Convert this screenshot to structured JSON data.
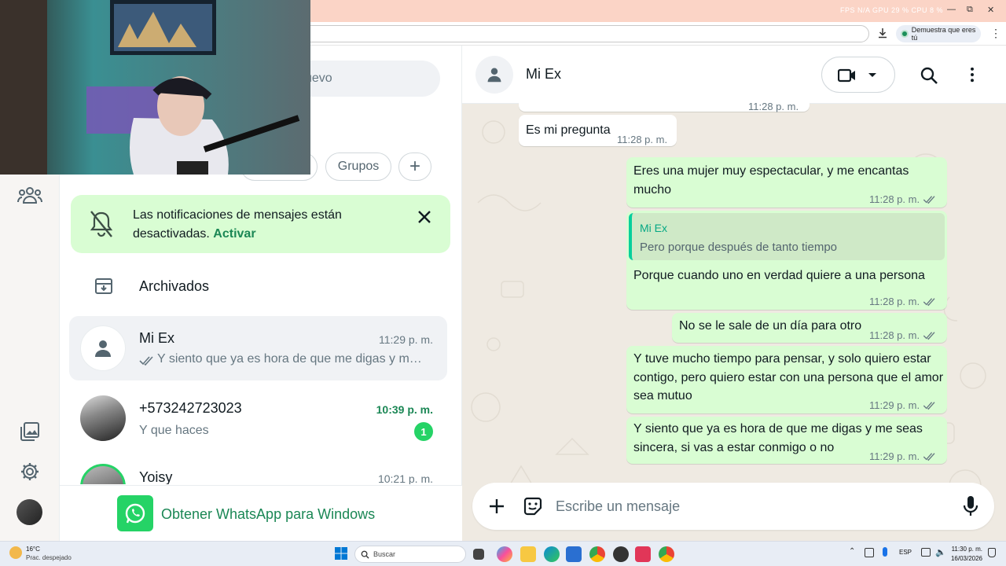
{
  "browser": {
    "stats_text": "FPS N/A   GPU 29 %   CPU 8 %",
    "verify_pill": "Demuestra que eres tú"
  },
  "list": {
    "search_placeholder": "uevo",
    "filters": [
      "Grupos"
    ],
    "notification": {
      "text": "Las notificaciones de mensajes están desactivadas.",
      "action": "Activar"
    },
    "archived_label": "Archivados",
    "chats": [
      {
        "name": "Mi Ex",
        "time": "11:29 p. m.",
        "preview": "Y siento que ya es hora de que me digas y me seas sincera, si vas a estar conmigo o no",
        "read_ticks": true,
        "unread": null
      },
      {
        "name": "+573242723023",
        "time": "10:39 p. m.",
        "preview": "Y que haces",
        "read_ticks": false,
        "unread": "1"
      },
      {
        "name": "Yoisy",
        "time": "10:21 p. m.",
        "preview": "",
        "read_ticks": false,
        "unread": null
      }
    ],
    "get_app_label": "Obtener WhatsApp para Windows"
  },
  "conversation": {
    "contact_name": "Mi Ex",
    "partial_time": "11:28 p. m.",
    "messages": [
      {
        "dir": "in",
        "text": "Es mi pregunta",
        "time": "11:28 p. m."
      },
      {
        "dir": "out",
        "text": "Eres una mujer muy espectacular, y me encantas mucho",
        "time": "11:28 p. m."
      },
      {
        "dir": "out",
        "quote_author": "Mi Ex",
        "quote_text": "Pero porque después de tanto tiempo",
        "text": "Porque cuando uno en verdad quiere a una persona",
        "time": "11:28 p. m."
      },
      {
        "dir": "out",
        "text": "No se le sale de un día para otro",
        "time": "11:28 p. m."
      },
      {
        "dir": "out",
        "text": "Y tuve mucho tiempo para pensar, y solo quiero estar contigo, pero quiero estar con una persona que el amor sea mutuo",
        "time": "11:29 p. m."
      },
      {
        "dir": "out",
        "text": "Y siento que ya es hora de que me digas y me seas sincera, si vas a estar conmigo o no",
        "time": "11:29 p. m."
      }
    ],
    "composer_placeholder": "Escribe un mensaje"
  },
  "taskbar": {
    "weather_temp": "16°C",
    "weather_desc": "Prac. despejado",
    "search_label": "Buscar",
    "lang": "ESP",
    "clock_time": "11:30 p. m.",
    "clock_date": "16/03/2026"
  },
  "colors": {
    "accent": "#1b8755",
    "bubble_out": "#d9fdd3",
    "chat_bg": "#efeae2",
    "unread_badge": "#25d366"
  }
}
